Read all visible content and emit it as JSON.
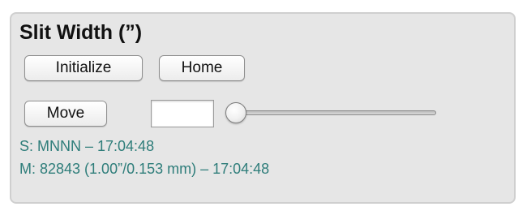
{
  "panel": {
    "title": "Slit Width (”)"
  },
  "buttons": {
    "initialize": "Initialize",
    "home": "Home",
    "move": "Move"
  },
  "move_input": {
    "value": ""
  },
  "slider": {
    "fraction": 0.0
  },
  "status": {
    "s_line": "S: MNNN – 17:04:48",
    "m_line": "M: 82843 (1.00”/0.153 mm) – 17:04:48"
  },
  "colors": {
    "panel_background": "#e6e6e6",
    "status_text": "#2e7d7a"
  }
}
